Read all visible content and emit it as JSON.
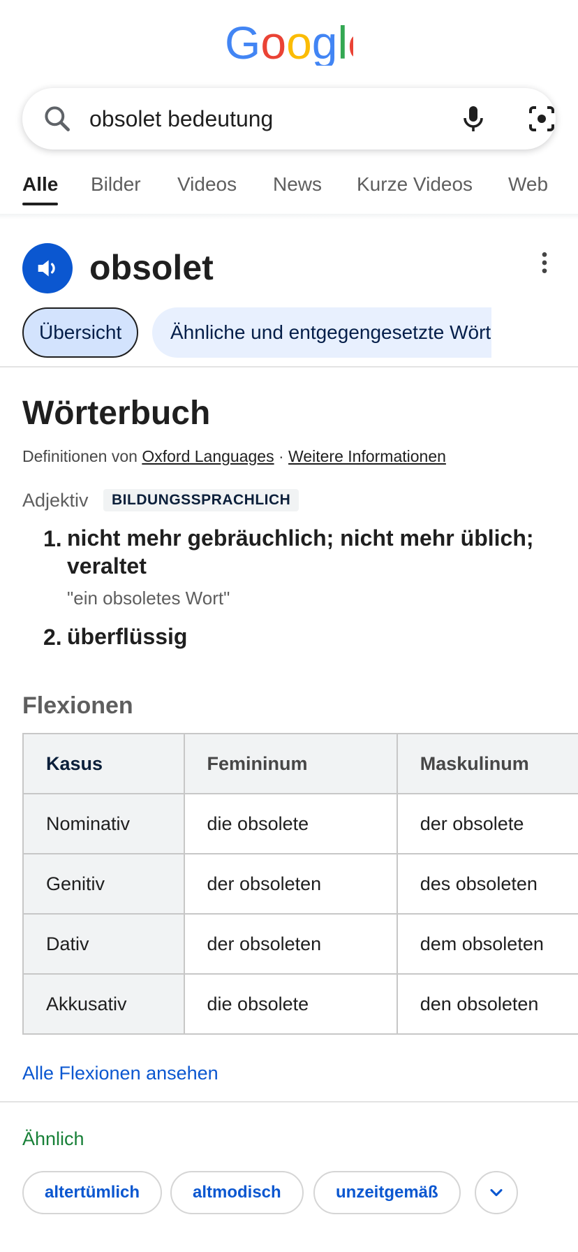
{
  "logo_text": "Google",
  "colors": {
    "blue": "#4285F4",
    "red": "#EA4335",
    "yellow": "#FBBC05",
    "green": "#34A853",
    "accent": "#0b57d0",
    "similar_green": "#188038"
  },
  "search": {
    "query": "obsolet bedeutung",
    "icons": [
      "search-icon",
      "microphone-icon",
      "lens-icon"
    ]
  },
  "tabs": [
    {
      "label": "Alle",
      "active": true
    },
    {
      "label": "Bilder",
      "active": false
    },
    {
      "label": "Videos",
      "active": false
    },
    {
      "label": "News",
      "active": false
    },
    {
      "label": "Kurze Videos",
      "active": false
    },
    {
      "label": "Web",
      "active": false
    }
  ],
  "word": {
    "headword": "obsolet",
    "icons": [
      "speaker-icon",
      "more-vert-icon"
    ]
  },
  "chips": {
    "overview": "Übersicht",
    "similar_opposite": "Ähnliche und entgegengesetzte Wörter"
  },
  "dictionary": {
    "title": "Wörterbuch",
    "source_prefix": "Definitionen von",
    "source_link": "Oxford Languages",
    "separator": "·",
    "more_info": "Weitere Informationen",
    "part_of_speech": "Adjektiv",
    "register": "BILDUNGSSPRACHLICH",
    "definitions": [
      {
        "num": "1.",
        "text": "nicht mehr gebräuchlich; nicht mehr üblich; veraltet",
        "example": "\"ein obsoletes Wort\""
      },
      {
        "num": "2.",
        "text": "überflüssig"
      }
    ]
  },
  "inflections": {
    "title": "Flexionen",
    "headers": [
      "Kasus",
      "Femininum",
      "Maskulinum"
    ],
    "rows": [
      [
        "Nominativ",
        "die obsolete",
        "der obsolete"
      ],
      [
        "Genitiv",
        "der obsoleten",
        "des obsoleten"
      ],
      [
        "Dativ",
        "der obsoleten",
        "dem obsoleten"
      ],
      [
        "Akkusativ",
        "die obsolete",
        "den obsoleten"
      ]
    ],
    "all_link": "Alle Flexionen ansehen"
  },
  "similar": {
    "title": "Ähnlich",
    "words": [
      "altertümlich",
      "altmodisch",
      "unzeitgemäß"
    ],
    "expand_icon": "chevron-down-icon"
  }
}
